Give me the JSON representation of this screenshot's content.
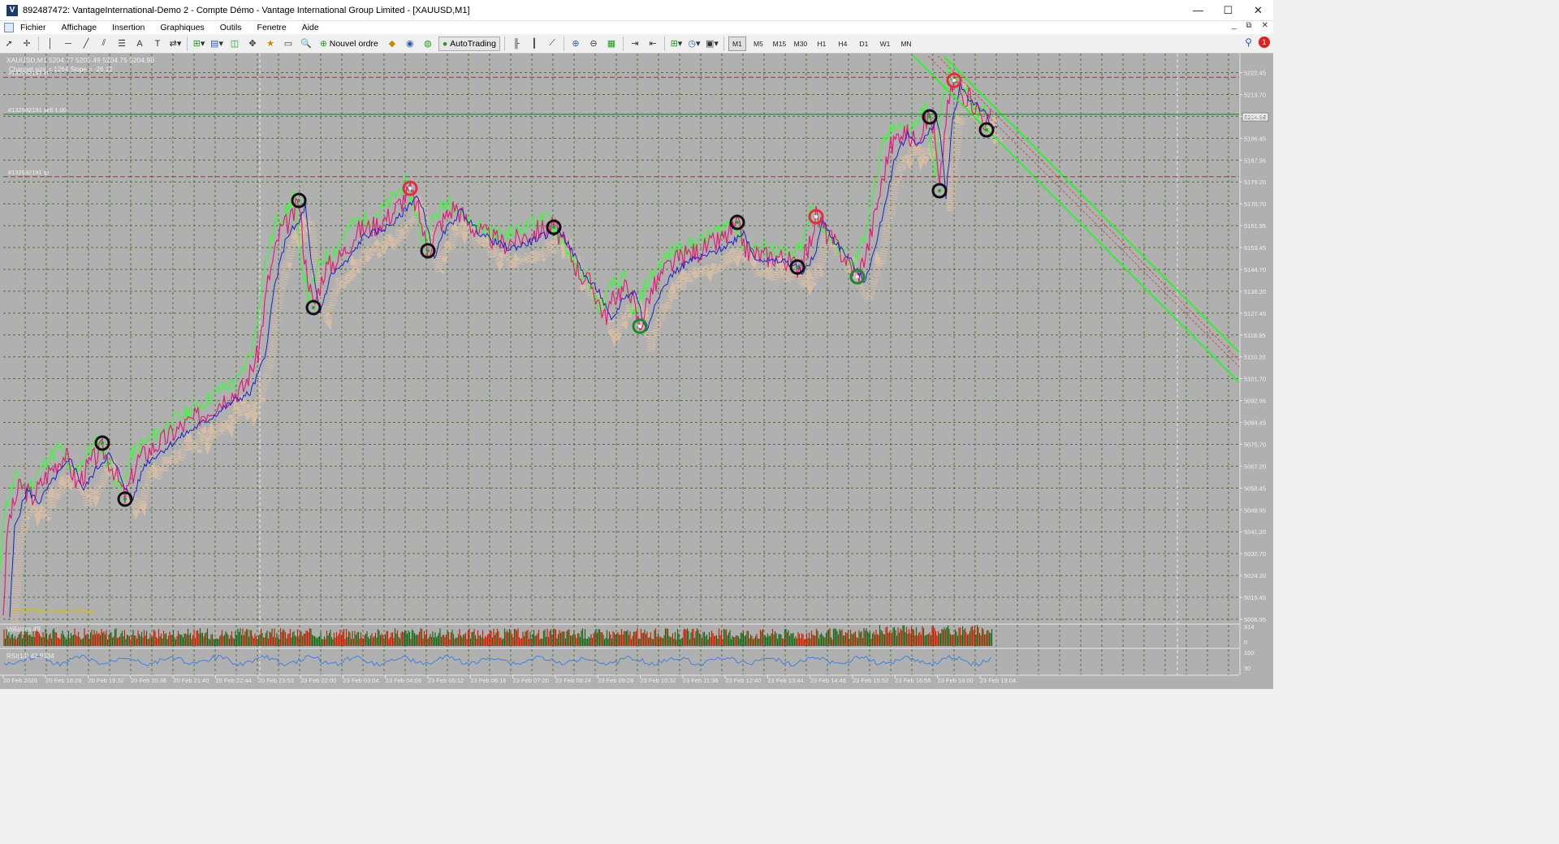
{
  "window": {
    "title": "892487472: VantageInternational-Demo 2 - Compte Démo - Vantage International Group Limited - [XAUUSD,M1]",
    "app_icon": "V",
    "minimize": "—",
    "maximize": "☐",
    "close": "✕"
  },
  "menu": {
    "items": [
      "Fichier",
      "Affichage",
      "Insertion",
      "Graphiques",
      "Outils",
      "Fenetre",
      "Aide"
    ],
    "mdi_minimize": "_",
    "mdi_restore": "⧉",
    "mdi_close": "✕"
  },
  "toolbar": {
    "new_order": "Nouvel ordre",
    "autotrading": "AutoTrading",
    "timeframes": [
      "M1",
      "M5",
      "M15",
      "M30",
      "H1",
      "H4",
      "D1",
      "W1",
      "MN"
    ],
    "active_timeframe": "M1",
    "alert_count": "1"
  },
  "chart": {
    "symbol_line": "XAUUSD,M1  5204.77 5205.49 5204.75 5204.98",
    "channel_info": "Channel size = 1264 Slope = -26.12",
    "order_labels": [
      {
        "text": "#132992191 sl",
        "price": 5220.6,
        "color": "#d02020"
      },
      {
        "text": "#132992191 sell 1.00",
        "price": 5206.0,
        "color": "#1a7a1a"
      },
      {
        "text": "#132992191 tp",
        "price": 5181.4,
        "color": "#d02020"
      }
    ],
    "current_price": "5204.98",
    "watermark": "© 2023 TopLessons.ru/Forex",
    "price_ticks": [
      "5222.45",
      "5213.70",
      "5204.95",
      "5196.45",
      "5187.95",
      "5179.20",
      "5170.70",
      "5161.95",
      "5153.45",
      "5144.70",
      "5136.20",
      "5127.45",
      "5118.95",
      "5110.20",
      "5101.70",
      "5092.95",
      "5084.45",
      "5075.70",
      "5067.20",
      "5058.45",
      "5049.95",
      "5041.20",
      "5032.70",
      "5024.20",
      "5015.45",
      "5006.95"
    ],
    "time_ticks": [
      "20 Feb 2026",
      "20 Feb 18:28",
      "20 Feb 19:32",
      "20 Feb 20:36",
      "20 Feb 21:40",
      "20 Feb 22:44",
      "20 Feb 23:53",
      "23 Feb 02:00",
      "23 Feb 03:04",
      "23 Feb 04:08",
      "23 Feb 05:12",
      "23 Feb 06:16",
      "23 Feb 07:20",
      "23 Feb 08:24",
      "23 Feb 09:28",
      "23 Feb 10:32",
      "23 Feb 11:36",
      "23 Feb 12:40",
      "23 Feb 13:44",
      "23 Feb 14:48",
      "23 Feb 15:52",
      "23 Feb 16:56",
      "23 Feb 18:00",
      "23 Feb 19:04"
    ],
    "volumes_label": "Volumes 49",
    "volume_ticks": [
      "914",
      "0"
    ],
    "rsi_label": "RSI(14) 42.9334",
    "rsi_ticks": [
      "100",
      "30"
    ],
    "colors": {
      "background": "#b0b0b0",
      "grid": "#556b3a",
      "price_green": "#33ff33",
      "price_magenta": "#e0207a",
      "ma_blue": "#2020c8",
      "band_peach": "#f5c8a0",
      "channel": "#33ee33",
      "volume_red": "#cc2200",
      "volume_green": "#1a6a1a",
      "rsi_line": "#4080e0"
    }
  }
}
